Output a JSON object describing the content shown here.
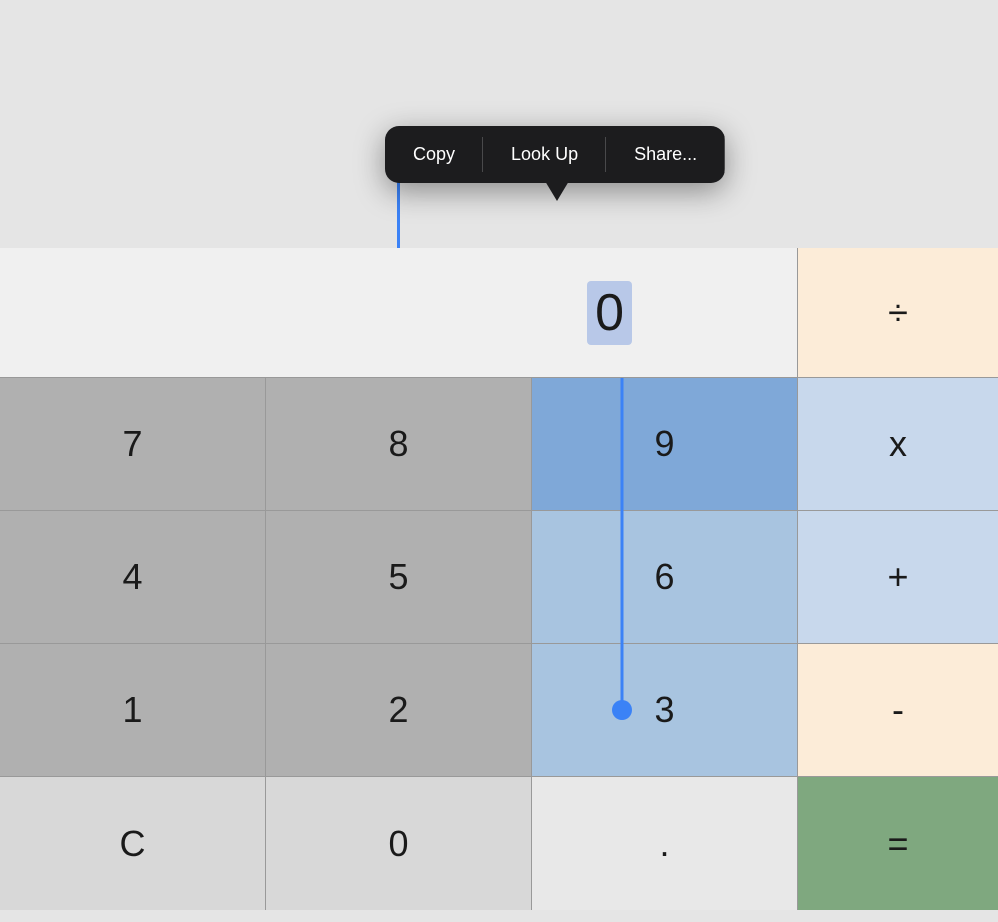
{
  "contextMenu": {
    "items": [
      {
        "id": "copy",
        "label": "Copy"
      },
      {
        "id": "lookup",
        "label": "Look Up"
      },
      {
        "id": "share",
        "label": "Share..."
      }
    ]
  },
  "display": {
    "value": "0",
    "operator": "÷"
  },
  "rows": [
    {
      "keys": [
        {
          "id": "7",
          "label": "7",
          "type": "num"
        },
        {
          "id": "8",
          "label": "8",
          "type": "num"
        },
        {
          "id": "9",
          "label": "9",
          "type": "selected"
        },
        {
          "id": "multiply",
          "label": "x",
          "type": "op-blue"
        }
      ]
    },
    {
      "keys": [
        {
          "id": "4",
          "label": "4",
          "type": "num"
        },
        {
          "id": "5",
          "label": "5",
          "type": "num"
        },
        {
          "id": "6",
          "label": "6",
          "type": "selected-light"
        },
        {
          "id": "add",
          "label": "+",
          "type": "op-blue"
        }
      ]
    },
    {
      "keys": [
        {
          "id": "1",
          "label": "1",
          "type": "num"
        },
        {
          "id": "2",
          "label": "2",
          "type": "num"
        },
        {
          "id": "3",
          "label": "3",
          "type": "selected-light"
        },
        {
          "id": "subtract",
          "label": "-",
          "type": "op"
        }
      ]
    },
    {
      "keys": [
        {
          "id": "clear",
          "label": "C",
          "type": "clear"
        },
        {
          "id": "0",
          "label": "0",
          "type": "zero"
        },
        {
          "id": "dot",
          "label": ".",
          "type": "dot"
        },
        {
          "id": "equals",
          "label": "=",
          "type": "equals"
        }
      ]
    }
  ],
  "colors": {
    "accent": "#3b82f6",
    "menuBg": "#1c1c1e",
    "menuText": "#ffffff",
    "numKey": "#b0b0b0",
    "selectedKey": "#7fa8d8",
    "selectedLightKey": "#a8c4e0",
    "opKey": "#fcecd8",
    "opBlueKey": "#c8d8ec",
    "equalsKey": "#7fa87f",
    "displayBg": "#f0f0f0",
    "calcBorder": "#999999"
  }
}
